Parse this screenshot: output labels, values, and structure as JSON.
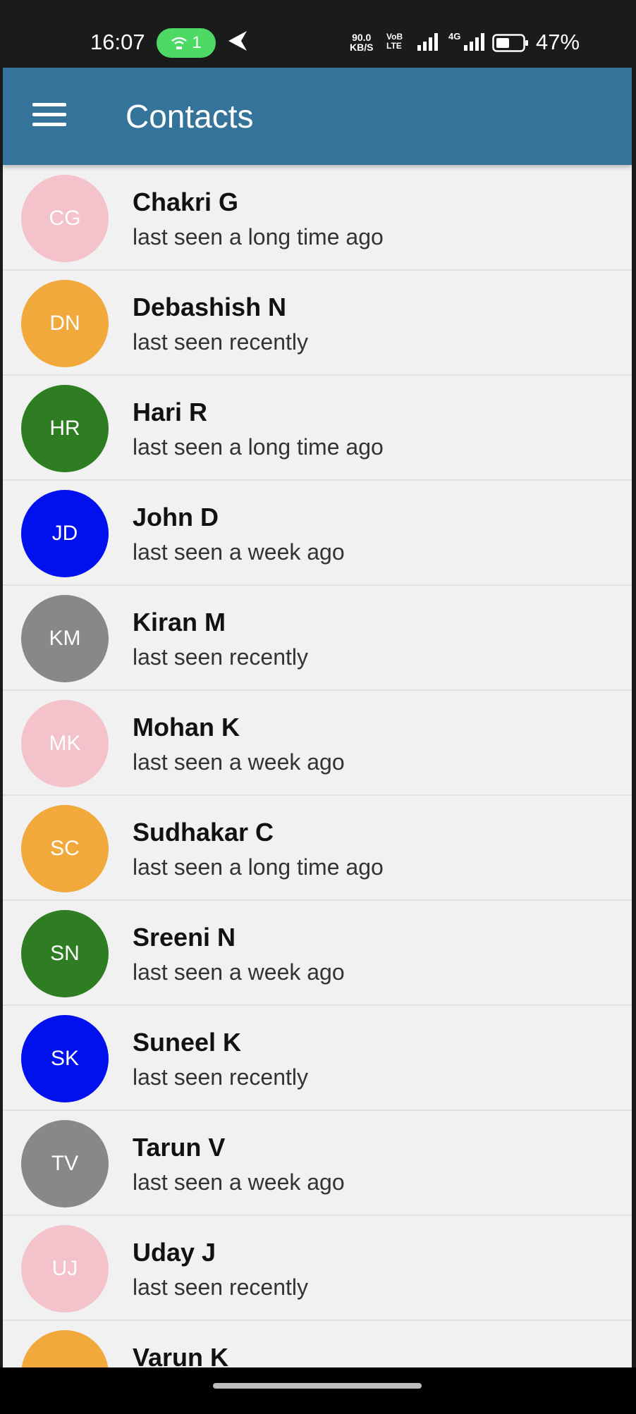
{
  "status_bar": {
    "time": "16:07",
    "hotspot_count": "1",
    "speed_value": "90.0",
    "speed_unit": "KB/S",
    "volte_top": "VoB",
    "volte_bottom": "LTE",
    "network": "4G",
    "battery": "47%"
  },
  "app_bar": {
    "title": "Contacts",
    "menu_icon": "hamburger-menu-icon",
    "color": "#35749a"
  },
  "contacts": [
    {
      "initials": "CG",
      "name": "Chakri G",
      "status": "last seen a long time ago",
      "color": "#f4c2cb",
      "text_color": "#ffffff"
    },
    {
      "initials": "DN",
      "name": "Debashish N",
      "status": "last seen recently",
      "color": "#f2a93b",
      "text_color": "#ffffff"
    },
    {
      "initials": "HR",
      "name": "Hari R",
      "status": "last seen a long time ago",
      "color": "#2f7d22",
      "text_color": "#ffffff"
    },
    {
      "initials": "JD",
      "name": "John D",
      "status": "last seen a week ago",
      "color": "#0011ee",
      "text_color": "#ffffff"
    },
    {
      "initials": "KM",
      "name": "Kiran M",
      "status": "last seen recently",
      "color": "#888888",
      "text_color": "#ffffff"
    },
    {
      "initials": "MK",
      "name": "Mohan K",
      "status": "last seen a week ago",
      "color": "#f4c2cb",
      "text_color": "#ffffff"
    },
    {
      "initials": "SC",
      "name": "Sudhakar C",
      "status": "last seen a long time ago",
      "color": "#f2a93b",
      "text_color": "#ffffff"
    },
    {
      "initials": "SN",
      "name": "Sreeni N",
      "status": "last seen a week ago",
      "color": "#2f7d22",
      "text_color": "#ffffff"
    },
    {
      "initials": "SK",
      "name": "Suneel K",
      "status": "last seen recently",
      "color": "#0011ee",
      "text_color": "#ffffff"
    },
    {
      "initials": "TV",
      "name": "Tarun V",
      "status": "last seen a week ago",
      "color": "#888888",
      "text_color": "#ffffff"
    },
    {
      "initials": "UJ",
      "name": "Uday J",
      "status": "last seen recently",
      "color": "#f4c2cb",
      "text_color": "#ffffff"
    },
    {
      "initials": "",
      "name": "Varun K",
      "status": "",
      "color": "#f2a93b",
      "text_color": "#ffffff"
    }
  ]
}
